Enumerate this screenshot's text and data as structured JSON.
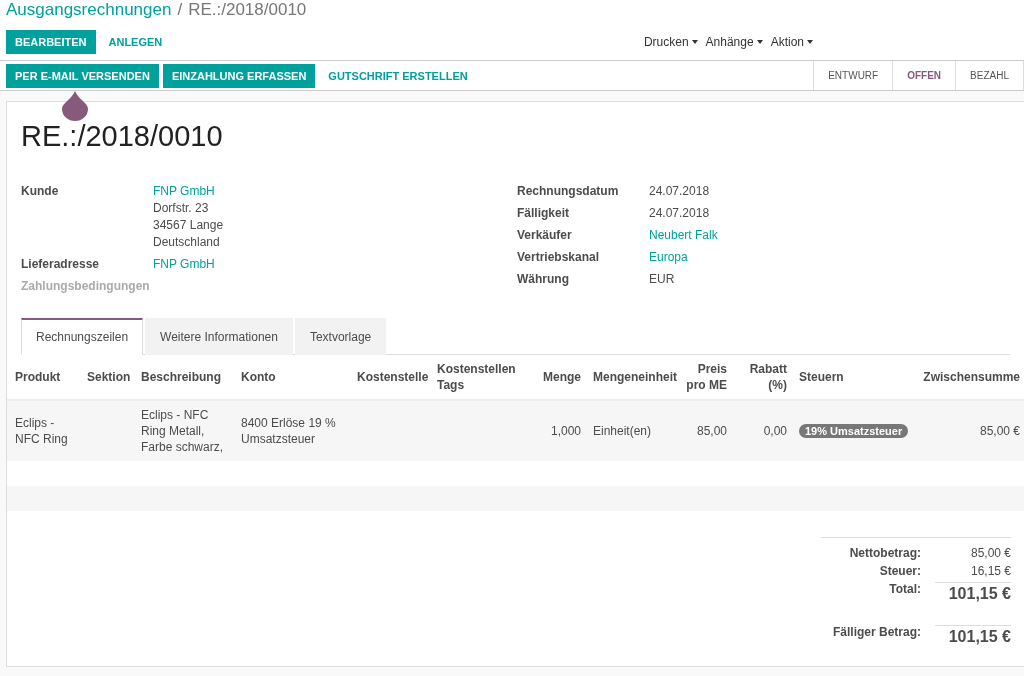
{
  "breadcrumb": {
    "parent": "Ausgangsrechnungen",
    "separator": "/",
    "current": "RE.:/2018/0010"
  },
  "control_buttons": [
    {
      "label": "BEARBEITEN",
      "primary": true
    },
    {
      "label": "ANLEGEN",
      "primary": false
    }
  ],
  "dropdowns": [
    "Drucken",
    "Anhänge",
    "Aktion"
  ],
  "action_buttons": [
    {
      "label": "PER E-MAIL VERSENDEN",
      "primary": true
    },
    {
      "label": "EINZAHLUNG ERFASSEN",
      "primary": true
    },
    {
      "label": "GUTSCHRIFT ERSTELLEN",
      "primary": false
    }
  ],
  "statuses": [
    {
      "label": "ENTWURF",
      "selected": false
    },
    {
      "label": "OFFEN",
      "selected": true
    },
    {
      "label": "BEZAHL",
      "selected": false
    }
  ],
  "title": "RE.:/2018/0010",
  "left_fields": [
    {
      "label": "Kunde",
      "lines": [
        "FNP GmbH",
        "Dorfstr. 23",
        "34567 Lange",
        "Deutschland"
      ],
      "link": true,
      "muted": false
    },
    {
      "label": "Lieferadresse",
      "lines": [
        "FNP GmbH"
      ],
      "link": true,
      "muted": false
    },
    {
      "label": "Zahlungsbedingungen",
      "muted": true
    }
  ],
  "right_fields": [
    {
      "label": "Rechnungsdatum",
      "value": "24.07.2018",
      "link": false
    },
    {
      "label": "Fälligkeit",
      "value": "24.07.2018",
      "link": false
    },
    {
      "label": "Verkäufer",
      "value": "Neubert Falk",
      "link": true
    },
    {
      "label": "Vertriebskanal",
      "value": "Europa",
      "link": true
    },
    {
      "label": "Währung",
      "value": "EUR",
      "link": false
    }
  ],
  "tabs": [
    {
      "label": "Rechnungszeilen",
      "selected": true
    },
    {
      "label": "Weitere Informationen",
      "selected": false
    },
    {
      "label": "Textvorlage",
      "selected": false
    }
  ],
  "table": {
    "columns": [
      "Produkt",
      "Sektion",
      "Beschreibung",
      "Konto",
      "Kostenstelle",
      "Kostenstellen Tags",
      "Menge",
      "Mengeneinheit",
      "Preis pro ME",
      "Rabatt (%)",
      "Steuern",
      "Zwischensumme"
    ],
    "rows": [
      {
        "cells": [
          "Eclips - NFC Ring",
          null,
          "Eclips - NFC Ring Metall, Farbe schwarz,",
          "8400 Erlöse 19 % Umsatzsteuer",
          null,
          null,
          "1,000",
          "Einheit(en)",
          "85,00",
          "0,00",
          "19% Umsatzsteuer",
          "85,00 €"
        ]
      }
    ]
  },
  "totals": [
    {
      "label": "Nettobetrag:",
      "value": "85,00 €",
      "big": false
    },
    {
      "label": "Steuer:",
      "value": "16,15 €",
      "big": false
    },
    {
      "label": "Total:",
      "value": "101,15 €",
      "big": true
    }
  ],
  "due": {
    "label": "Fälliger Betrag:",
    "value": "101,15 €"
  }
}
